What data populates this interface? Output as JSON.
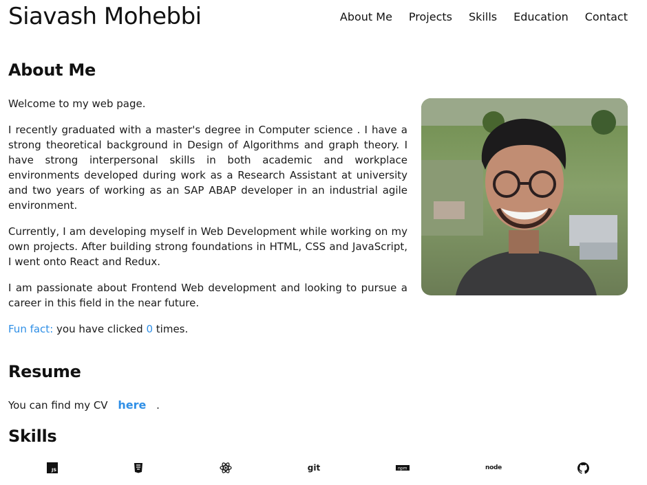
{
  "header": {
    "title": "Siavash Mohebbi",
    "nav": [
      "About Me",
      "Projects",
      "Skills",
      "Education",
      "Contact"
    ]
  },
  "about": {
    "title": "About Me",
    "welcome": "Welcome to my web page.",
    "p1": "I recently graduated with a master's degree in Computer science . I have a strong theoretical background in Design of Algorithms and graph theory. I have strong interpersonal skills in both academic and workplace environments developed during work as a Research Assistant at university and two years of working as an SAP ABAP developer in an industrial agile environment.",
    "p2": "Currently, I am developing myself in Web Development while working on my own projects. After building strong foundations in HTML, CSS and JavaScript, I went onto React and Redux.",
    "p3": "I am passionate about Frontend Web development and looking to pursue a career in this field in the near future.",
    "fun_fact_label": "Fun fact:",
    "fun_fact_text": "you have clicked",
    "click_count": "0",
    "times": "times."
  },
  "resume": {
    "title": "Resume",
    "text": "You can find my CV",
    "link": "here",
    "end": "."
  },
  "skills": {
    "title": "Skills",
    "icons": [
      "javascript-icon",
      "html5-icon",
      "react-icon",
      "git-icon",
      "npm-icon",
      "nodejs-icon",
      "github-icon"
    ],
    "js_text": "JS",
    "git_text": "git",
    "npm_text": "npm",
    "node_text": "node"
  },
  "colors": {
    "accent": "#2f8fe6"
  }
}
